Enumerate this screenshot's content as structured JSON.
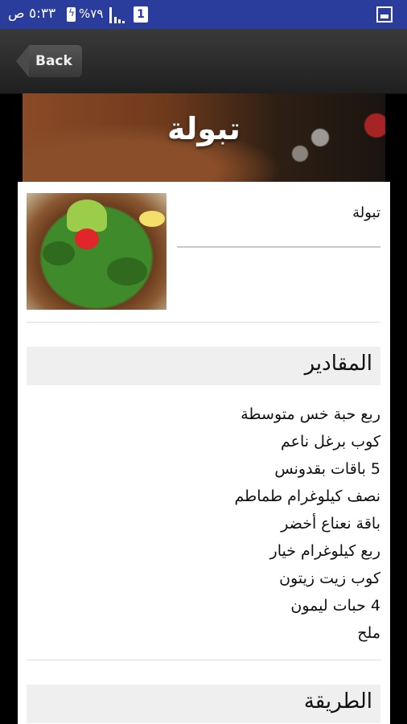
{
  "status_bar": {
    "time": "٥:٣٣ ص",
    "battery": "%٧٩",
    "sim": "1",
    "icons": [
      "battery-charging-icon",
      "signal-icon",
      "sim-icon",
      "gallery-icon"
    ]
  },
  "nav": {
    "back_label": "Back"
  },
  "hero": {
    "title": "تبولة"
  },
  "recipe": {
    "name": "تبولة",
    "ingredients_title": "المقادير",
    "ingredients": [
      "ربع حبة خس متوسطة",
      "كوب برغل ناعم",
      "5 باقات بقدونس",
      "نصف كيلوغرام طماطم",
      "باقة نعناع أخضر",
      "ربع كيلوغرام خيار",
      "كوب زيت زيتون",
      "4 حبات ليمون",
      "ملح"
    ],
    "method_title": "الطريقة"
  },
  "colors": {
    "status_bar": "#2a3d9c",
    "nav_bar": "#2b2b2b",
    "section_bg": "#efefef"
  }
}
